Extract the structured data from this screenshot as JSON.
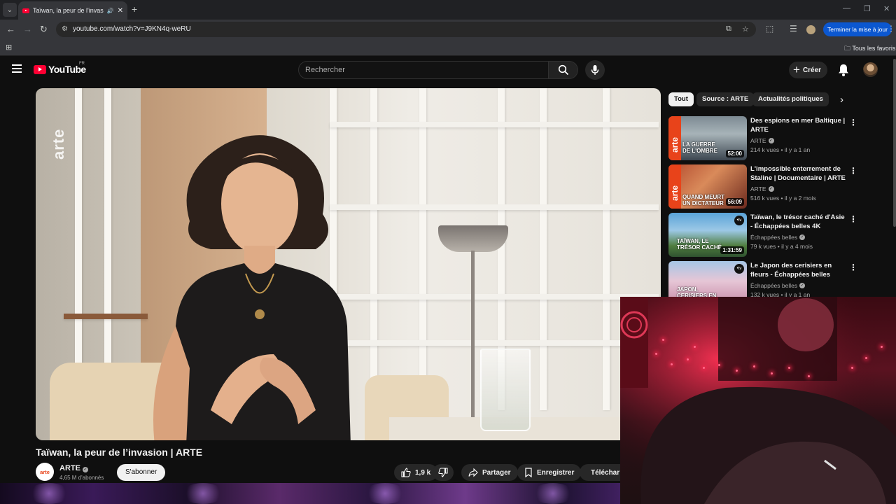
{
  "browser": {
    "tab_title": "Taïwan, la peur de l'invasion",
    "url": "youtube.com/watch?v=J9KN4q-weRU",
    "update_button": "Terminer la mise à jour",
    "bookmarks_label": "Tous les favoris"
  },
  "youtube": {
    "logo_text": "YouTube",
    "region": "FR",
    "search_placeholder": "Rechercher",
    "create_label": "Créer"
  },
  "video": {
    "title": "Taïwan, la peur de l’invasion | ARTE",
    "channel": "ARTE",
    "channel_avatar_text": "arte",
    "subscribers": "4,65 M d'abonnés",
    "subscribe_label": "S'abonner",
    "likes": "1,9 k",
    "share_label": "Partager",
    "save_label": "Enregistrer",
    "download_label": "Téléchar",
    "watermark": "arte"
  },
  "chips": [
    "Tout",
    "Source : ARTE",
    "Actualités politiques"
  ],
  "recommendations": [
    {
      "title": "Des espions en mer Baltique | ARTE",
      "channel": "ARTE",
      "views": "214 k vues",
      "age": "il y a 1 an",
      "duration": "52:00",
      "thumb_text": "LA GUERRE DE L'OMBRE"
    },
    {
      "title": "L'impossible enterrement de Staline | Documentaire | ARTE",
      "channel": "ARTE",
      "views": "516 k vues",
      "age": "il y a 2 mois",
      "duration": "56:09",
      "thumb_text": "QUAND MEURT UN DICTATEUR"
    },
    {
      "title": "Taïwan, le trésor caché d'Asie - Échappées belles 4K",
      "channel": "Échappées belles",
      "views": "79 k vues",
      "age": "il y a 4 mois",
      "duration": "1:31:59",
      "thumb_text": "TAÏWAN, LE TRÉSOR CACHÉ"
    },
    {
      "title": "Le Japon des cerisiers en fleurs - Échappées belles",
      "channel": "Échappées belles",
      "views": "132 k vues",
      "age": "il y a 1 an",
      "duration": "",
      "thumb_text": "JAPON, CERISIERS EN FLEUR"
    }
  ],
  "colors": {
    "youtube_red": "#ff0033",
    "arte_orange": "#e8431a",
    "chrome_blue": "#0b57d0"
  }
}
